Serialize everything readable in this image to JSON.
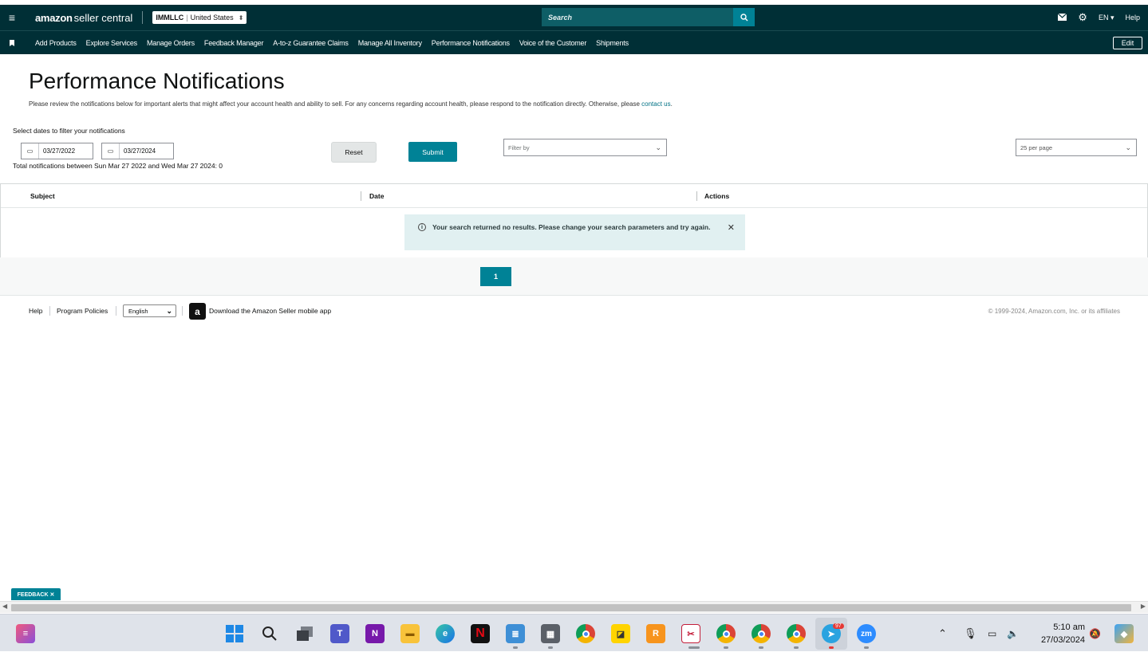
{
  "topbar": {
    "brand_main": "amazon",
    "brand_sub": "seller central",
    "account_name": "IMMLLC",
    "account_region": "United States",
    "search_placeholder": "Search",
    "lang": "EN ▾",
    "help": "Help"
  },
  "nav": {
    "items": [
      "Add Products",
      "Explore Services",
      "Manage Orders",
      "Feedback Manager",
      "A-to-z Guarantee Claims",
      "Manage All Inventory",
      "Performance Notifications",
      "Voice of the Customer",
      "Shipments"
    ],
    "edit": "Edit"
  },
  "page": {
    "title": "Performance Notifications",
    "description": "Please review the notifications below for important alerts that might affect your account health and ability to sell. For any concerns regarding account health, please respond to the notification directly. Otherwise, please ",
    "contact_link": "contact us",
    "description_end": "."
  },
  "filters": {
    "label": "Select dates to filter your notifications",
    "start_date": "03/27/2022",
    "end_date": "03/27/2024",
    "reset": "Reset",
    "submit": "Submit",
    "filter_by_placeholder": "Filter by",
    "per_page": "25 per page",
    "total": "Total notifications between Sun Mar 27 2022 and Wed Mar 27 2024: 0"
  },
  "table": {
    "columns": [
      "Subject",
      "Date",
      "Actions"
    ],
    "empty_message": "Your search returned no results. Please change your search parameters and try again."
  },
  "pagination": {
    "current_page": "1"
  },
  "footer": {
    "help": "Help",
    "policies": "Program Policies",
    "language": "English",
    "app_link": "Download the Amazon Seller mobile app",
    "copyright": "© 1999-2024, Amazon.com, Inc. or its affiliates"
  },
  "feedback": "FEEDBACK ✕",
  "taskbar": {
    "time": "5:10 am",
    "date": "27/03/2024",
    "telegram_badge": "97",
    "icons": [
      "widgets-icon",
      "windows-start-icon",
      "search-icon",
      "task-view-icon",
      "teams-icon",
      "onenote-icon",
      "file-explorer-icon",
      "edge-icon",
      "netflix-icon",
      "notepad-icon",
      "calculator-icon",
      "chrome-icon",
      "sticky-notes-icon",
      "ringcentral-icon",
      "snipping-tool-icon",
      "chrome-profile-1-icon",
      "chrome-profile-2-icon",
      "chrome-profile-3-icon",
      "telegram-icon",
      "zoom-icon"
    ]
  },
  "colors": {
    "header_bg": "#002f36",
    "accent": "#008296",
    "alert_bg": "#e1f0f1"
  }
}
